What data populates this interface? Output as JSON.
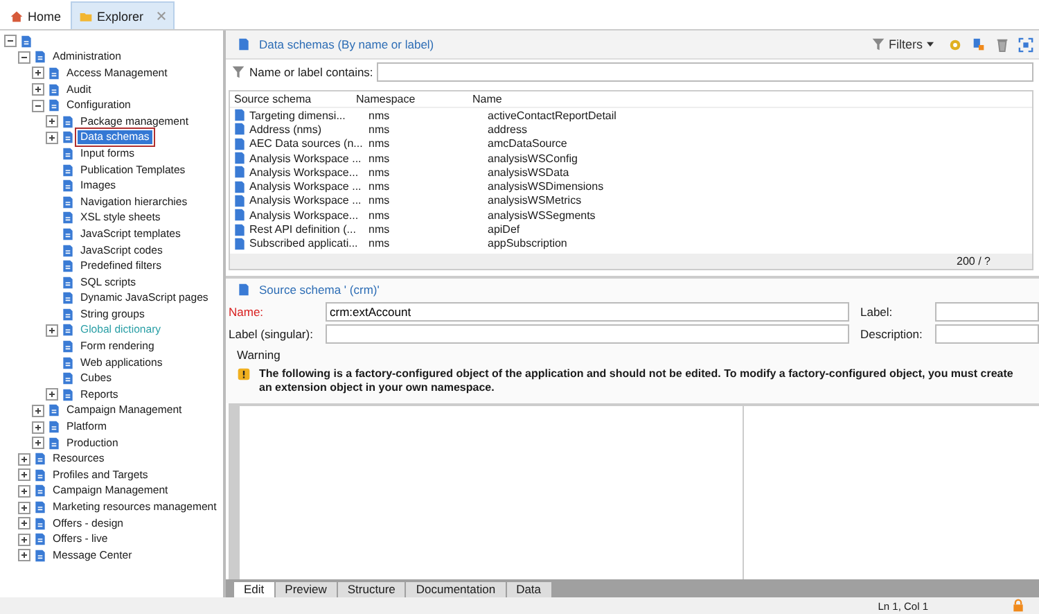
{
  "tabs": [
    {
      "label": "Home",
      "selected": false,
      "closable": false
    },
    {
      "label": "Explorer",
      "selected": true,
      "closable": true
    }
  ],
  "tree": [
    {
      "expanded": true,
      "children": [
        {
          "label": "Administration",
          "expanded": true,
          "selected": false,
          "children": [
            {
              "label": "Access Management",
              "expanded": false,
              "selected": false
            },
            {
              "label": "Audit",
              "expanded": false,
              "selected": false
            },
            {
              "label": "Configuration",
              "expanded": true,
              "selected": false,
              "children": [
                {
                  "label": "Package management",
                  "expanded": false,
                  "selected": false
                },
                {
                  "label": "Data schemas",
                  "expanded": false,
                  "selected": true
                },
                {
                  "label": "Input forms",
                  "selected": false
                },
                {
                  "label": "Publication Templates",
                  "selected": false
                },
                {
                  "label": "Images",
                  "selected": false
                },
                {
                  "label": "Navigation hierarchies",
                  "selected": false
                },
                {
                  "label": "XSL style sheets",
                  "selected": false
                },
                {
                  "label": "JavaScript templates",
                  "selected": false
                },
                {
                  "label": "JavaScript codes",
                  "selected": false
                },
                {
                  "label": "Predefined filters",
                  "selected": false
                },
                {
                  "label": "SQL scripts",
                  "selected": false
                },
                {
                  "label": "Dynamic JavaScript pages",
                  "selected": false
                },
                {
                  "label": "String groups",
                  "selected": false
                },
                {
                  "label": "Global dictionary",
                  "expanded": false,
                  "selected": false,
                  "color": "#2a9fa6"
                },
                {
                  "label": "Form rendering",
                  "selected": false
                },
                {
                  "label": "Web applications",
                  "selected": false
                },
                {
                  "label": "Cubes",
                  "selected": false
                },
                {
                  "label": "Reports",
                  "expanded": false,
                  "selected": false
                }
              ]
            },
            {
              "label": "Campaign Management",
              "expanded": false,
              "selected": false
            },
            {
              "label": "Platform",
              "expanded": false,
              "selected": false
            },
            {
              "label": "Production",
              "expanded": false,
              "selected": false
            }
          ]
        },
        {
          "label": "Resources",
          "expanded": false,
          "selected": false
        },
        {
          "label": "Profiles and Targets",
          "expanded": false,
          "selected": false
        },
        {
          "label": "Campaign Management",
          "expanded": false,
          "selected": false
        },
        {
          "label": "Marketing resources management",
          "expanded": false,
          "selected": false
        },
        {
          "label": "Offers - design",
          "expanded": false,
          "selected": false
        },
        {
          "label": "Offers - live",
          "expanded": false,
          "selected": false
        },
        {
          "label": "Message Center",
          "expanded": false,
          "selected": false
        }
      ]
    }
  ],
  "list": {
    "title": "Data schemas (By name or label)",
    "filters_label": "Filters",
    "filter_label": "Name or label contains:",
    "columns": [
      "Source schema",
      "Namespace",
      "Name"
    ],
    "rows": [
      [
        "Targeting dimensi...",
        "nms",
        "activeContactReportDetail"
      ],
      [
        "Address (nms)",
        "nms",
        "address"
      ],
      [
        "AEC Data sources (n...",
        "nms",
        "amcDataSource"
      ],
      [
        "Analysis Workspace ...",
        "nms",
        "analysisWSConfig"
      ],
      [
        "Analysis Workspace...",
        "nms",
        "analysisWSData"
      ],
      [
        "Analysis Workspace ...",
        "nms",
        "analysisWSDimensions"
      ],
      [
        "Analysis Workspace ...",
        "nms",
        "analysisWSMetrics"
      ],
      [
        "Analysis Workspace...",
        "nms",
        "analysisWSSegments"
      ],
      [
        "Rest API definition (...",
        "nms",
        "apiDef"
      ],
      [
        "Subscribed applicati...",
        "nms",
        "appSubscription"
      ]
    ],
    "count": "200 / ?"
  },
  "detail": {
    "title": "Source schema ' (crm)'",
    "name_label": "Name:",
    "name_value": "crm:extAccount",
    "label_label": "Label:",
    "singular_label": "Label (singular):",
    "description_label": "Description:",
    "warning_title": "Warning",
    "warning_text": "The following is a factory-configured object of the application and should not be edited. To modify a factory-configured object, you must create an extension object in your own namespace."
  },
  "editor_tabs": [
    {
      "label": "Edit",
      "selected": true
    },
    {
      "label": "Preview",
      "selected": false
    },
    {
      "label": "Structure",
      "selected": false
    },
    {
      "label": "Documentation",
      "selected": false
    },
    {
      "label": "Data",
      "selected": false
    }
  ],
  "status_bar": {
    "position": "Ln 1, Col 1"
  }
}
